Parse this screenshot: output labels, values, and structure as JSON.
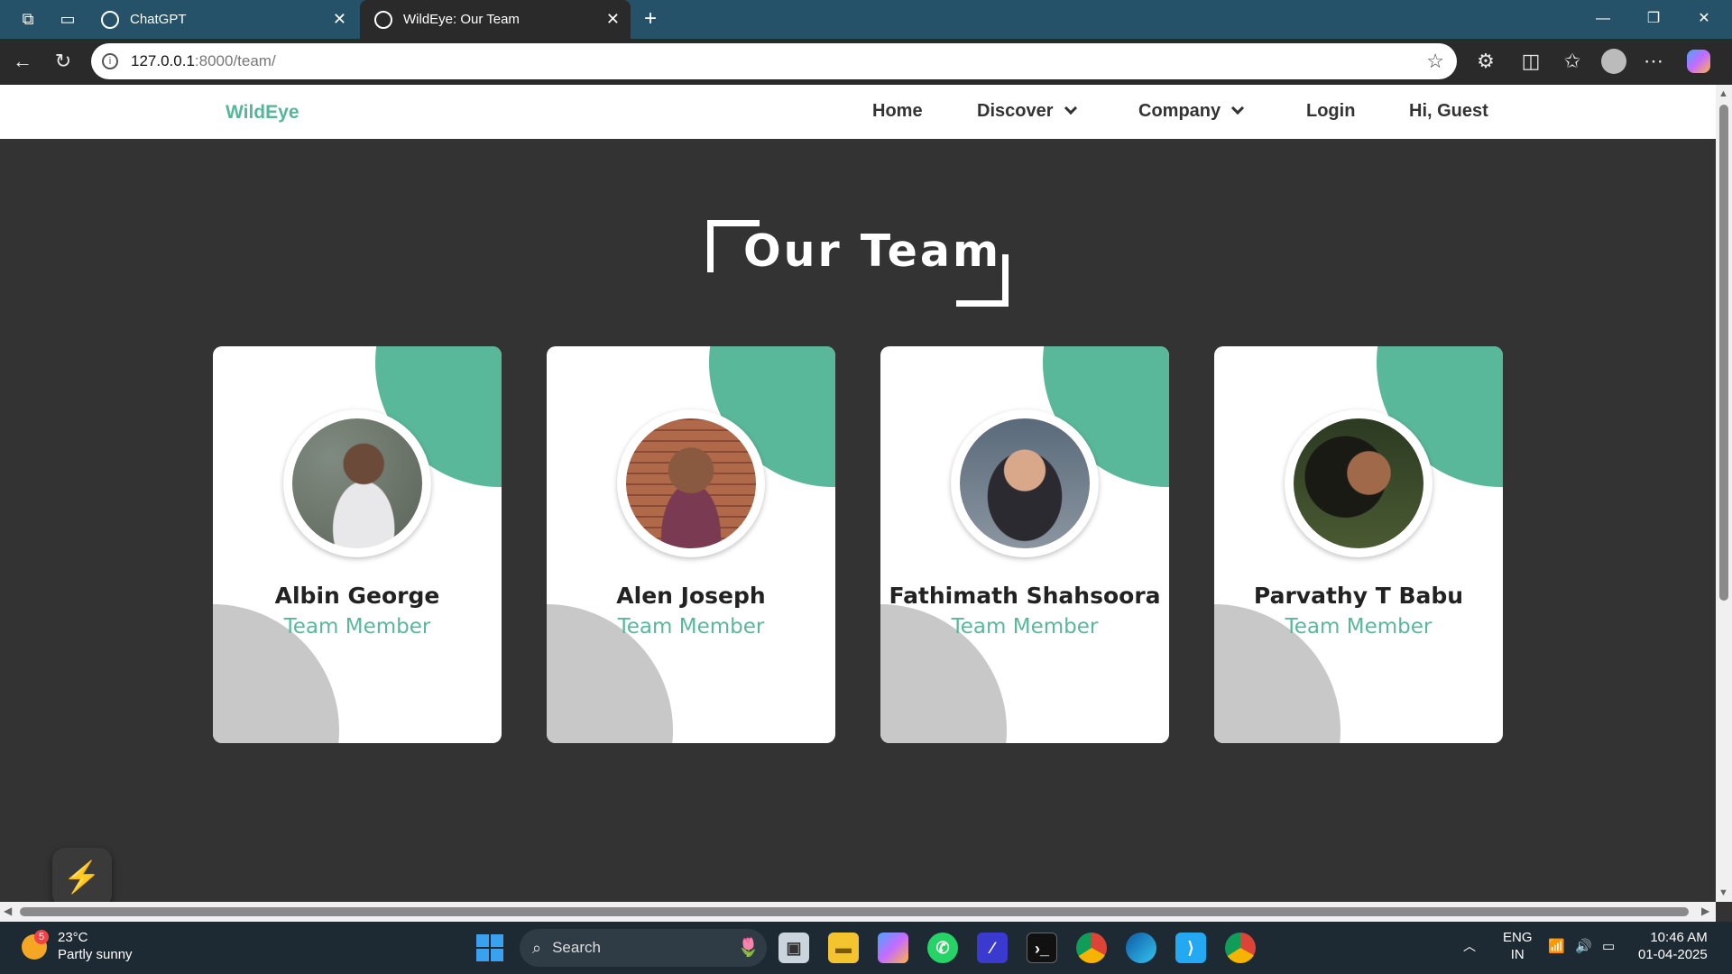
{
  "browser": {
    "tabs": [
      {
        "title": "ChatGPT"
      },
      {
        "title": "WildEye: Our Team"
      }
    ],
    "address": {
      "host": "127.0.0.1",
      "path": ":8000/team/"
    }
  },
  "site": {
    "logo": "WildEye",
    "menu": [
      {
        "label": "Home"
      },
      {
        "label": "Discover"
      },
      {
        "label": "Company"
      },
      {
        "label": "Login"
      },
      {
        "label": "Hi, Guest"
      }
    ],
    "heading": "Our Team",
    "members": [
      {
        "name": "Albin George",
        "role": "Team Member"
      },
      {
        "name": "Alen Joseph",
        "role": "Team Member"
      },
      {
        "name": "Fathimath Shahsoora",
        "role": "Team Member"
      },
      {
        "name": "Parvathy T Babu",
        "role": "Team Member"
      }
    ],
    "accent_color": "#5ab89a"
  },
  "taskbar": {
    "weather": {
      "temp": "23°C",
      "desc": "Partly sunny",
      "badge": "5"
    },
    "search_label": "Search",
    "lang": {
      "line1": "ENG",
      "line2": "IN"
    },
    "clock": {
      "time": "10:46 AM",
      "date": "01-04-2025"
    }
  }
}
